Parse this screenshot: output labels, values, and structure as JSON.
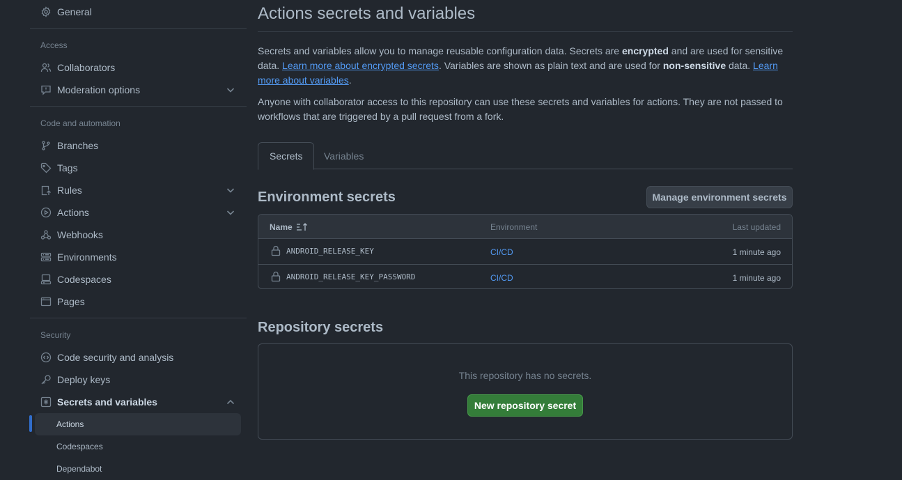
{
  "sidebar": {
    "general": "General",
    "access_label": "Access",
    "collaborators": "Collaborators",
    "moderation": "Moderation options",
    "code_automation_label": "Code and automation",
    "branches": "Branches",
    "tags": "Tags",
    "rules": "Rules",
    "actions": "Actions",
    "webhooks": "Webhooks",
    "environments": "Environments",
    "codespaces": "Codespaces",
    "pages": "Pages",
    "security_label": "Security",
    "code_security": "Code security and analysis",
    "deploy_keys": "Deploy keys",
    "secrets_variables": "Secrets and variables",
    "sub_actions": "Actions",
    "sub_codespaces": "Codespaces",
    "sub_dependabot": "Dependabot"
  },
  "main": {
    "title": "Actions secrets and variables",
    "intro": {
      "p1_a": "Secrets and variables allow you to manage reusable configuration data. Secrets are ",
      "p1_b": "encrypted",
      "p1_c": " and are used for sensitive data. ",
      "p1_link1": "Learn more about encrypted secrets",
      "p1_d": ". Variables are shown as plain text and are used for ",
      "p1_e": "non-sensitive",
      "p1_f": " data. ",
      "p1_link2": "Learn more about variables",
      "p1_g": ".",
      "p2": "Anyone with collaborator access to this repository can use these secrets and variables for actions. They are not passed to workflows that are triggered by a pull request from a fork."
    },
    "tabs": [
      "Secrets",
      "Variables"
    ],
    "env_secrets": {
      "heading": "Environment secrets",
      "manage_button": "Manage environment secrets",
      "columns": {
        "name": "Name",
        "environment": "Environment",
        "updated": "Last updated"
      },
      "rows": [
        {
          "name": "ANDROID_RELEASE_KEY",
          "environment": "CI/CD",
          "updated": "1 minute ago"
        },
        {
          "name": "ANDROID_RELEASE_KEY_PASSWORD",
          "environment": "CI/CD",
          "updated": "1 minute ago"
        }
      ]
    },
    "repo_secrets": {
      "heading": "Repository secrets",
      "empty_text": "This repository has no secrets.",
      "new_button": "New repository secret"
    }
  },
  "colors": {
    "background": "#22272e",
    "accent_blue": "#539bf5",
    "primary_green": "#347d39"
  }
}
